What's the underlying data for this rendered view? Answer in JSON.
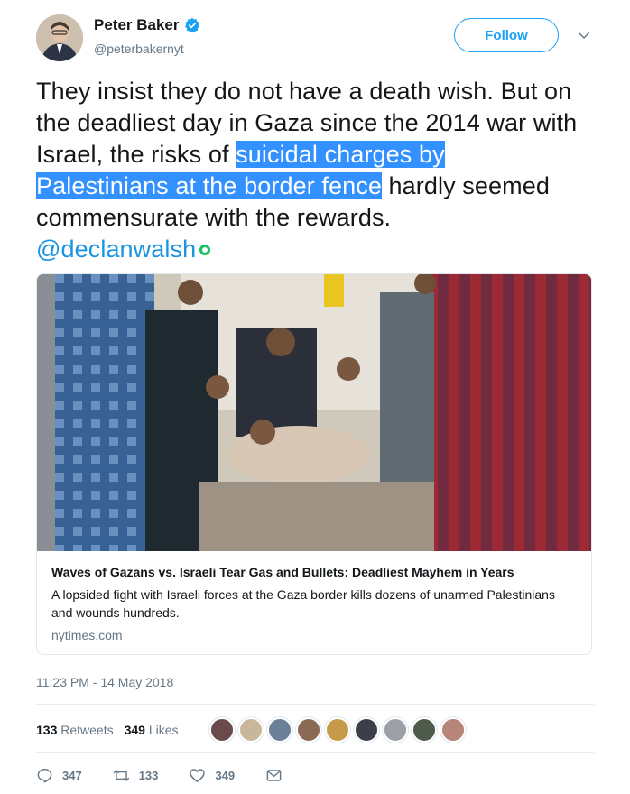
{
  "author": {
    "name": "Peter Baker",
    "handle": "@peterbakernyt",
    "verified": true,
    "follow_label": "Follow"
  },
  "tweet": {
    "text_before": "They insist they do not have a death wish. But on the deadliest day in Gaza since the 2014 war with Israel, the risks of ",
    "text_highlight_1": "suicidal charges by",
    "text_highlight_2": "Palestinians at the border fence",
    "text_after": " hardly seemed commensurate with the rewards. ",
    "mention": "@declanwalsh"
  },
  "card": {
    "title": "Waves of Gazans vs. Israeli Tear Gas and Bullets: Deadliest Mayhem in Years",
    "description": "A lopsided fight with Israeli forces at the Gaza border kills dozens of unarmed Palestinians and wounds hundreds.",
    "domain": "nytimes.com"
  },
  "timestamp": "11:23 PM - 14 May 2018",
  "stats": {
    "retweets_count": "133",
    "retweets_label": "Retweets",
    "likes_count": "349",
    "likes_label": "Likes"
  },
  "likers": [
    "#6a4a4a",
    "#c9b79b",
    "#6b7f96",
    "#8a6a55",
    "#c79a4a",
    "#3a3f4a",
    "#9aa0a6",
    "#4f5b4a",
    "#b7857a"
  ],
  "actions": {
    "reply_count": "347",
    "retweet_count": "133",
    "like_count": "349"
  },
  "colors": {
    "accent": "#1da1f2",
    "highlight": "#3390ff",
    "mention": "#1b95e0",
    "muted": "#657786"
  }
}
